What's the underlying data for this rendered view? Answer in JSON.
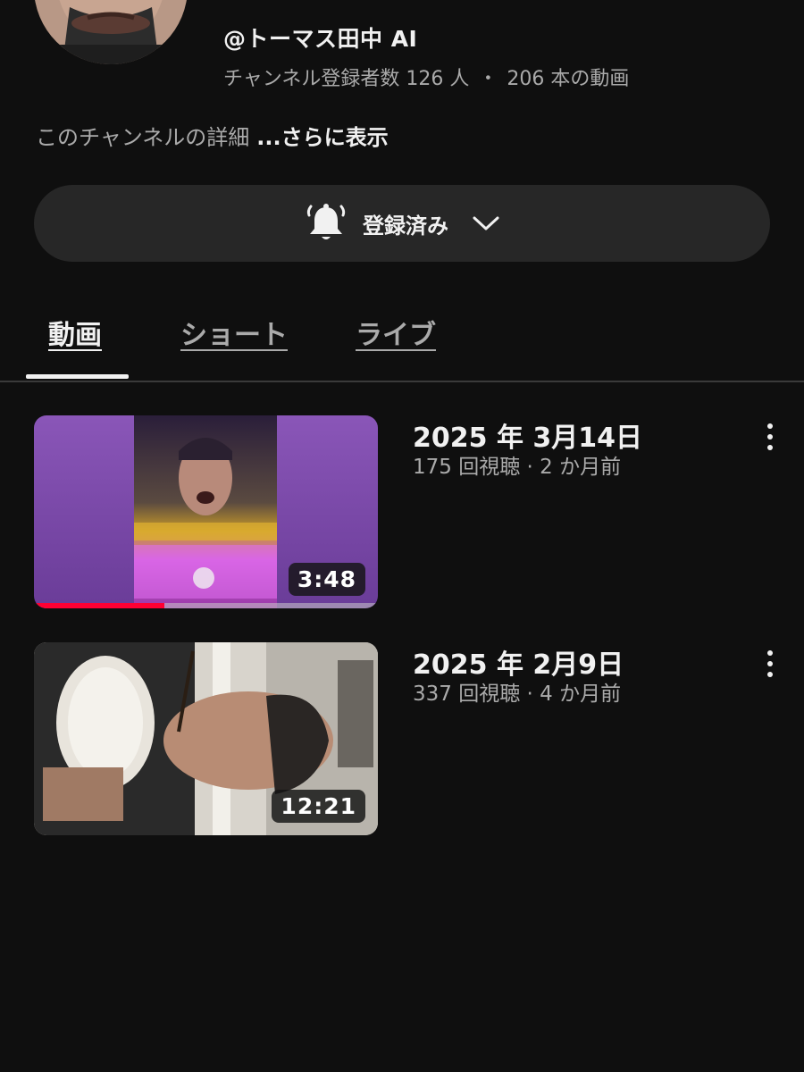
{
  "channel": {
    "handle": "@トーマス田中 AI",
    "subscribers": "チャンネル登録者数 126 人",
    "separator": "・",
    "video_count": "206 本の動画",
    "description": "このチャンネルの詳細",
    "more_label": "...さらに表示",
    "avatar_icon": "channel-avatar-photo"
  },
  "subscribe": {
    "label": "登録済み",
    "bell_icon": "bell-icon",
    "chevron_icon": "chevron-down-icon"
  },
  "tabs": [
    {
      "label": "動画",
      "active": true
    },
    {
      "label": "ショート",
      "active": false
    },
    {
      "label": "ライブ",
      "active": false
    }
  ],
  "videos": [
    {
      "title": "2025 年 3月14日",
      "meta": "175 回視聴 · 2 か月前",
      "duration": "3:48",
      "watched_fraction": 0.38,
      "thumbnail": "purple-framed-anime-slot-thumbnail"
    },
    {
      "title": "2025 年 2月9日",
      "meta": "337 回視聴 · 4 か月前",
      "duration": "12:21",
      "watched_fraction": 0,
      "thumbnail": "man-eating-from-bowl-thumbnail"
    }
  ],
  "colors": {
    "background": "#0f0f0f",
    "pill": "#272727",
    "secondary_text": "#aaaaaa",
    "progress": "#ff0033",
    "thumb_purple": "#7a4aa8"
  }
}
